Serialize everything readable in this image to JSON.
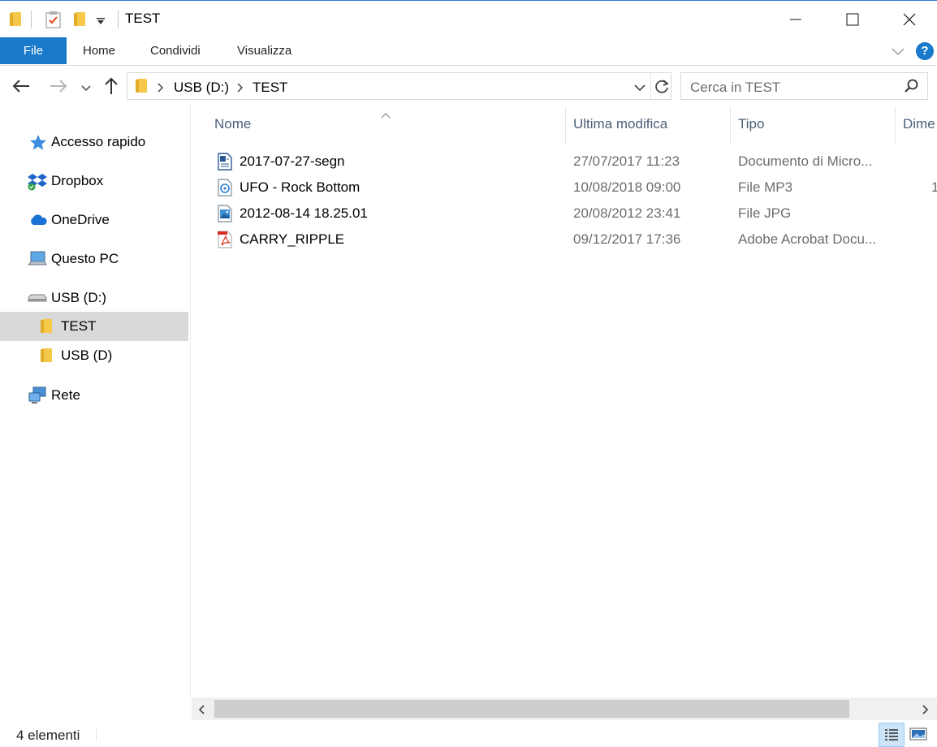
{
  "window": {
    "title": "TEST",
    "buttons": [
      "minimize",
      "maximize",
      "close"
    ]
  },
  "ribbon": {
    "tabs": [
      "File",
      "Home",
      "Condividi",
      "Visualizza"
    ],
    "help": "?"
  },
  "nav": {
    "path": [
      "USB (D:)",
      "TEST"
    ],
    "search_placeholder": "Cerca in TEST"
  },
  "sidebar": {
    "items": [
      {
        "label": "Accesso rapido",
        "icon": "star-icon"
      },
      {
        "label": "Dropbox",
        "icon": "dropbox-icon"
      },
      {
        "label": "OneDrive",
        "icon": "cloud-icon"
      },
      {
        "label": "Questo PC",
        "icon": "computer-icon"
      },
      {
        "label": "USB (D:)",
        "icon": "usb-drive-icon"
      },
      {
        "label": "TEST",
        "icon": "folder-icon",
        "selected": true
      },
      {
        "label": "USB (D)",
        "icon": "folder-icon"
      },
      {
        "label": "Rete",
        "icon": "network-icon"
      }
    ]
  },
  "columns": {
    "name": "Nome",
    "modified": "Ultima modifica",
    "type": "Tipo",
    "size": "Dime"
  },
  "files": [
    {
      "name": "2017-07-27-segn",
      "modified": "27/07/2017 11:23",
      "type": "Documento di Micro...",
      "size": "",
      "icon": "word-doc-icon"
    },
    {
      "name": "UFO - Rock Bottom",
      "modified": "10/08/2018 09:00",
      "type": "File MP3",
      "size": "1",
      "icon": "audio-file-icon"
    },
    {
      "name": "2012-08-14 18.25.01",
      "modified": "20/08/2012 23:41",
      "type": "File JPG",
      "size": "",
      "icon": "image-file-icon"
    },
    {
      "name": "CARRY_RIPPLE",
      "modified": "09/12/2017 17:36",
      "type": "Adobe Acrobat Docu...",
      "size": "",
      "icon": "pdf-file-icon"
    }
  ],
  "status": {
    "count": "4 elementi"
  },
  "colors": {
    "accent": "#1979ca",
    "selected_bg": "#d9d9d9",
    "header_text": "#4c607a"
  }
}
